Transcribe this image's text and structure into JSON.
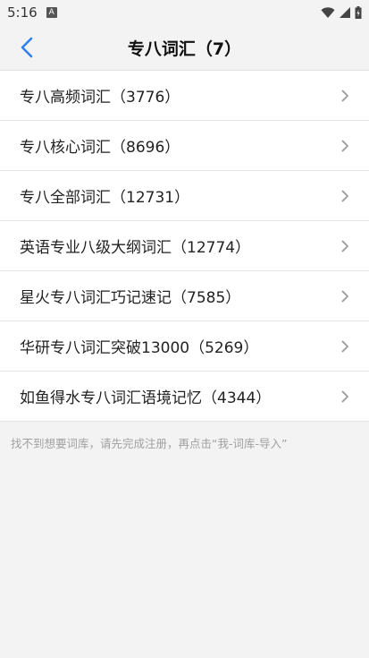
{
  "status_bar": {
    "time": "5:16",
    "notification_icon": "A"
  },
  "nav": {
    "title": "专八词汇（7）"
  },
  "items": [
    {
      "label": "专八高频词汇（3776）"
    },
    {
      "label": "专八核心词汇（8696）"
    },
    {
      "label": "专八全部词汇（12731）"
    },
    {
      "label": "英语专业八级大纲词汇（12774）"
    },
    {
      "label": "星火专八词汇巧记速记（7585）"
    },
    {
      "label": "华研专八词汇突破13000（5269）"
    },
    {
      "label": "如鱼得水专八词汇语境记忆（4344）"
    }
  ],
  "hint": "找不到想要词库，请先完成注册，再点击“我-词库-导入”",
  "colors": {
    "accent": "#2f80ed",
    "background": "#f3f3f3",
    "list_background": "#ffffff"
  }
}
